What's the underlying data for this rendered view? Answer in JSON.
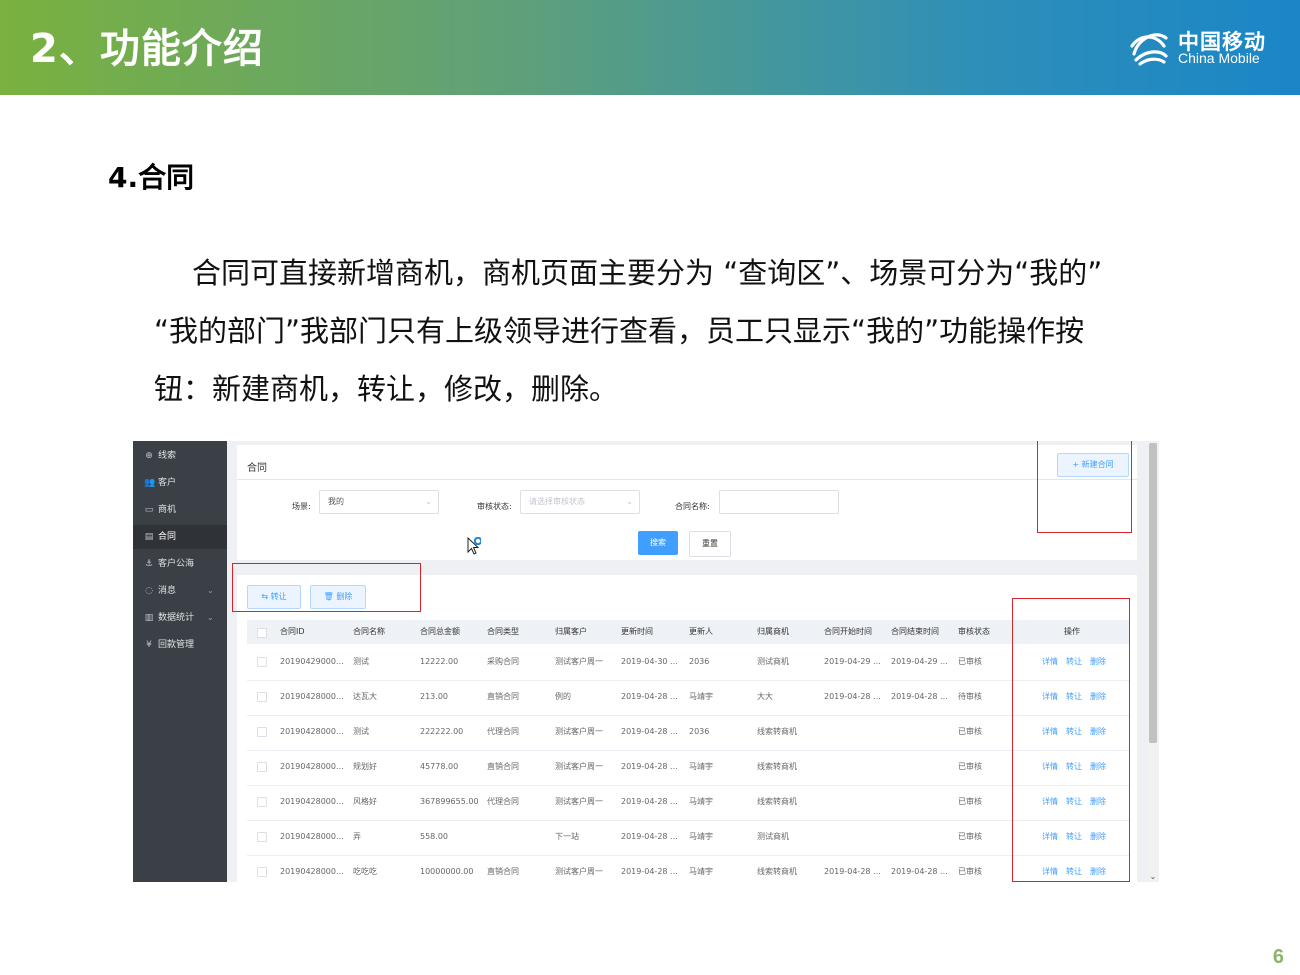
{
  "header": {
    "title": "2、功能介绍",
    "logo_cn": "中国移动",
    "logo_en": "China Mobile"
  },
  "section_title": "4.合同",
  "paragraph": "合同可直接新增商机，商机页面主要分为 “查询区”、场景可分为“我的” “我的部门”我部门只有上级领导进行查看，员工只显示“我的”功能操作按钮：新建商机，转让，修改，删除。",
  "page_number": "6",
  "screenshot": {
    "sidebar": [
      {
        "label": "线索",
        "icon": "target-icon",
        "glyph": "⊕",
        "active": false,
        "chevron": false
      },
      {
        "label": "客户",
        "icon": "users-icon",
        "glyph": "👥",
        "active": false,
        "chevron": false
      },
      {
        "label": "商机",
        "icon": "card-icon",
        "glyph": "▭",
        "active": false,
        "chevron": false
      },
      {
        "label": "合同",
        "icon": "document-icon",
        "glyph": "▤",
        "active": true,
        "chevron": false
      },
      {
        "label": "客户公海",
        "icon": "anchor-icon",
        "glyph": "⚓",
        "active": false,
        "chevron": false
      },
      {
        "label": "消息",
        "icon": "chat-icon",
        "glyph": "◌",
        "active": false,
        "chevron": true
      },
      {
        "label": "数据统计",
        "icon": "bar-chart-icon",
        "glyph": "▥",
        "active": false,
        "chevron": true
      },
      {
        "label": "回款管理",
        "icon": "yen-icon",
        "glyph": "¥",
        "active": false,
        "chevron": false
      }
    ],
    "card_title": "合同",
    "new_button": "+ 新建合同",
    "filters": {
      "scene_label": "场景:",
      "scene_value": "我的",
      "audit_label": "审核状态:",
      "audit_placeholder": "请选择审核状态",
      "name_label": "合同名称:",
      "name_value": ""
    },
    "search_button": "搜索",
    "reset_button": "重置",
    "transfer_button": "⇆ 转让",
    "delete_button": "🗑 删除",
    "columns": [
      "合同ID",
      "合同名称",
      "合同总金额",
      "合同类型",
      "归属客户",
      "更新时间",
      "更新人",
      "归属商机",
      "合同开始时间",
      "合同结束时间",
      "审核状态",
      "操作"
    ],
    "rows": [
      [
        "20190429000...",
        "测试",
        "12222.00",
        "采购合同",
        "测试客户周一",
        "2019-04-30 ...",
        "2036",
        "测试商机",
        "2019-04-29 ...",
        "2019-04-29 ...",
        "已审核"
      ],
      [
        "20190428000...",
        "达瓦大",
        "213.00",
        "直销合同",
        "例的",
        "2019-04-28 ...",
        "马靖宇",
        "大大",
        "2019-04-28 ...",
        "2019-04-28 ...",
        "待审核"
      ],
      [
        "20190428000...",
        "测试",
        "222222.00",
        "代理合同",
        "测试客户周一",
        "2019-04-28 ...",
        "2036",
        "线索转商机",
        "",
        "",
        "已审核"
      ],
      [
        "20190428000...",
        "规划好",
        "45778.00",
        "直销合同",
        "测试客户周一",
        "2019-04-28 ...",
        "马靖宇",
        "线索转商机",
        "",
        "",
        "已审核"
      ],
      [
        "20190428000...",
        "风格好",
        "367899655.00",
        "代理合同",
        "测试客户周一",
        "2019-04-28 ...",
        "马靖宇",
        "线索转商机",
        "",
        "",
        "已审核"
      ],
      [
        "20190428000...",
        "弄",
        "558.00",
        "",
        "下一站",
        "2019-04-28 ...",
        "马靖宇",
        "测试商机",
        "",
        "",
        "已审核"
      ],
      [
        "20190428000...",
        "吃吃吃",
        "10000000.00",
        "直销合同",
        "测试客户周一",
        "2019-04-28 ...",
        "马靖宇",
        "线索转商机",
        "2019-04-28 ...",
        "2019-04-28 ...",
        "已审核"
      ]
    ],
    "ops": [
      "详情",
      "转让",
      "删除"
    ]
  }
}
